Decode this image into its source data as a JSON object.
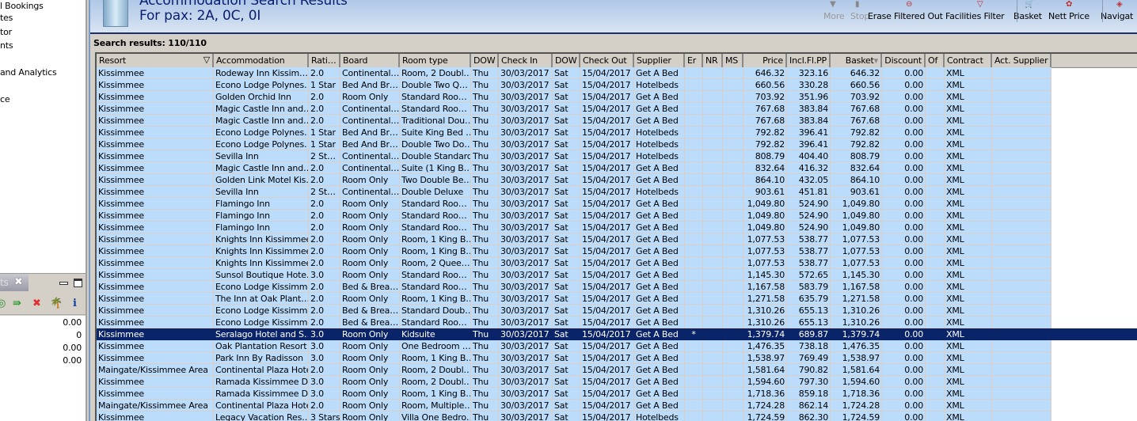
{
  "left_panel": {
    "nav_items": [
      "l Bookings",
      "tes",
      "tor",
      "nts",
      "and Analytics",
      "ce"
    ],
    "tab_label": "ts",
    "values": [
      "0.00",
      "0",
      "0.00",
      "0.00"
    ]
  },
  "header": {
    "title": "Accommodation Search Results",
    "subtitle": "For pax: 2A, 0C, 0I",
    "toolbar": [
      {
        "label": "More",
        "icon": "more-icon",
        "enabled": false
      },
      {
        "label": "Stop",
        "icon": "stop-icon",
        "enabled": false
      },
      {
        "label": "Erase Filtered Out",
        "icon": "erase-filter-icon",
        "enabled": true
      },
      {
        "label": "Facilities Filter",
        "icon": "funnel-icon",
        "enabled": true
      },
      {
        "label": "Basket",
        "icon": "basket-icon",
        "enabled": true
      },
      {
        "label": "Nett Price",
        "icon": "nett-price-icon",
        "enabled": true
      },
      {
        "label": "Navigat",
        "icon": "navigator-icon",
        "enabled": true
      }
    ]
  },
  "results_label": "Search results: 110/110",
  "table": {
    "columns": [
      "Resort",
      "Accommodation",
      "Rati…",
      "Board",
      "Room type",
      "DOW",
      "Check In",
      "DOW",
      "Check Out",
      "Supplier",
      "Er",
      "NR",
      "MS",
      "Price",
      "Incl.Fl.PP",
      "Basket",
      "Discount",
      "Of",
      "Contract",
      "Act. Supplier"
    ],
    "selected_row": 22,
    "rows": [
      [
        "Kissimmee",
        "Rodeway Inn Kissim…",
        "2.0",
        "Continental…",
        "Room, 2 Doubl…",
        "Thu",
        "30/03/2017",
        "Sat",
        "15/04/2017",
        "Get A Bed",
        "",
        "",
        "",
        "646.32",
        "323.16",
        "646.32",
        "0.00",
        "",
        "XML",
        ""
      ],
      [
        "Kissimmee",
        "Econo Lodge Polynes…",
        "1 Star",
        "Bed And Br…",
        "Double Two Q…",
        "Thu",
        "30/03/2017",
        "Sat",
        "15/04/2017",
        "Hotelbeds",
        "",
        "",
        "",
        "660.56",
        "330.28",
        "660.56",
        "0.00",
        "",
        "XML",
        ""
      ],
      [
        "Kissimmee",
        "Golden Orchid Inn",
        "2.0",
        "Room Only",
        "Standard Roo…",
        "Thu",
        "30/03/2017",
        "Sat",
        "15/04/2017",
        "Get A Bed",
        "",
        "",
        "",
        "703.92",
        "351.96",
        "703.92",
        "0.00",
        "",
        "XML",
        ""
      ],
      [
        "Kissimmee",
        "Magic Castle Inn and…",
        "2.0",
        "Continental…",
        "Standard Roo…",
        "Thu",
        "30/03/2017",
        "Sat",
        "15/04/2017",
        "Get A Bed",
        "",
        "",
        "",
        "767.68",
        "383.84",
        "767.68",
        "0.00",
        "",
        "XML",
        ""
      ],
      [
        "Kissimmee",
        "Magic Castle Inn and…",
        "2.0",
        "Continental…",
        "Traditional Dou…",
        "Thu",
        "30/03/2017",
        "Sat",
        "15/04/2017",
        "Get A Bed",
        "",
        "",
        "",
        "767.68",
        "383.84",
        "767.68",
        "0.00",
        "",
        "XML",
        ""
      ],
      [
        "Kissimmee",
        "Econo Lodge Polynes…",
        "1 Star",
        "Bed And Br…",
        "Suite King Bed …",
        "Thu",
        "30/03/2017",
        "Sat",
        "15/04/2017",
        "Hotelbeds",
        "",
        "",
        "",
        "792.82",
        "396.41",
        "792.82",
        "0.00",
        "",
        "XML",
        ""
      ],
      [
        "Kissimmee",
        "Econo Lodge Polynes…",
        "1 Star",
        "Bed And Br…",
        "Double Two Do…",
        "Thu",
        "30/03/2017",
        "Sat",
        "15/04/2017",
        "Hotelbeds",
        "",
        "",
        "",
        "792.82",
        "396.41",
        "792.82",
        "0.00",
        "",
        "XML",
        ""
      ],
      [
        "Kissimmee",
        "Sevilla Inn",
        "2 St…",
        "Continental…",
        "Double Standard",
        "Thu",
        "30/03/2017",
        "Sat",
        "15/04/2017",
        "Hotelbeds",
        "",
        "",
        "",
        "808.79",
        "404.40",
        "808.79",
        "0.00",
        "",
        "XML",
        ""
      ],
      [
        "Kissimmee",
        "Magic Castle Inn and…",
        "2.0",
        "Continental…",
        "Suite (1 King B…",
        "Thu",
        "30/03/2017",
        "Sat",
        "15/04/2017",
        "Get A Bed",
        "",
        "",
        "",
        "832.64",
        "416.32",
        "832.64",
        "0.00",
        "",
        "XML",
        ""
      ],
      [
        "Kissimmee",
        "Golden Link Motel Kis…",
        "2.0",
        "Room Only",
        "Two Double Be…",
        "Thu",
        "30/03/2017",
        "Sat",
        "15/04/2017",
        "Get A Bed",
        "",
        "",
        "",
        "864.10",
        "432.05",
        "864.10",
        "0.00",
        "",
        "XML",
        ""
      ],
      [
        "Kissimmee",
        "Sevilla Inn",
        "2 St…",
        "Continental…",
        "Double Deluxe",
        "Thu",
        "30/03/2017",
        "Sat",
        "15/04/2017",
        "Hotelbeds",
        "",
        "",
        "",
        "903.61",
        "451.81",
        "903.61",
        "0.00",
        "",
        "XML",
        ""
      ],
      [
        "Kissimmee",
        "Flamingo Inn",
        "2.0",
        "Room Only",
        "Standard Roo…",
        "Thu",
        "30/03/2017",
        "Sat",
        "15/04/2017",
        "Get A Bed",
        "",
        "",
        "",
        "1,049.80",
        "524.90",
        "1,049.80",
        "0.00",
        "",
        "XML",
        ""
      ],
      [
        "Kissimmee",
        "Flamingo Inn",
        "2.0",
        "Room Only",
        "Standard Roo…",
        "Thu",
        "30/03/2017",
        "Sat",
        "15/04/2017",
        "Get A Bed",
        "",
        "",
        "",
        "1,049.80",
        "524.90",
        "1,049.80",
        "0.00",
        "",
        "XML",
        ""
      ],
      [
        "Kissimmee",
        "Flamingo Inn",
        "2.0",
        "Room Only",
        "Standard Roo…",
        "Thu",
        "30/03/2017",
        "Sat",
        "15/04/2017",
        "Get A Bed",
        "",
        "",
        "",
        "1,049.80",
        "524.90",
        "1,049.80",
        "0.00",
        "",
        "XML",
        ""
      ],
      [
        "Kissimmee",
        "Knights Inn Kissimmee",
        "2.0",
        "Room Only",
        "Room, 1 King B…",
        "Thu",
        "30/03/2017",
        "Sat",
        "15/04/2017",
        "Get A Bed",
        "",
        "",
        "",
        "1,077.53",
        "538.77",
        "1,077.53",
        "0.00",
        "",
        "XML",
        ""
      ],
      [
        "Kissimmee",
        "Knights Inn Kissimmee",
        "2.0",
        "Room Only",
        "Room, 1 King B…",
        "Thu",
        "30/03/2017",
        "Sat",
        "15/04/2017",
        "Get A Bed",
        "",
        "",
        "",
        "1,077.53",
        "538.77",
        "1,077.53",
        "0.00",
        "",
        "XML",
        ""
      ],
      [
        "Kissimmee",
        "Knights Inn Kissimmee",
        "2.0",
        "Room Only",
        "Room, 2 Quee…",
        "Thu",
        "30/03/2017",
        "Sat",
        "15/04/2017",
        "Get A Bed",
        "",
        "",
        "",
        "1,077.53",
        "538.77",
        "1,077.53",
        "0.00",
        "",
        "XML",
        ""
      ],
      [
        "Kissimmee",
        "Sunsol Boutique Hote…",
        "3.0",
        "Room Only",
        "Standard Roo…",
        "Thu",
        "30/03/2017",
        "Sat",
        "15/04/2017",
        "Get A Bed",
        "",
        "",
        "",
        "1,145.30",
        "572.65",
        "1,145.30",
        "0.00",
        "",
        "XML",
        ""
      ],
      [
        "Kissimmee",
        "Econo Lodge Kissimmee",
        "2.0",
        "Bed & Brea…",
        "Standard Roo…",
        "Thu",
        "30/03/2017",
        "Sat",
        "15/04/2017",
        "Get A Bed",
        "",
        "",
        "",
        "1,167.58",
        "583.79",
        "1,167.58",
        "0.00",
        "",
        "XML",
        ""
      ],
      [
        "Kissimmee",
        "The Inn at Oak Plant…",
        "2.0",
        "Room Only",
        "Room, 1 King B…",
        "Thu",
        "30/03/2017",
        "Sat",
        "15/04/2017",
        "Get A Bed",
        "",
        "",
        "",
        "1,271.58",
        "635.79",
        "1,271.58",
        "0.00",
        "",
        "XML",
        ""
      ],
      [
        "Kissimmee",
        "Econo Lodge Kissimmee",
        "2.0",
        "Bed & Brea…",
        "Standard Doub…",
        "Thu",
        "30/03/2017",
        "Sat",
        "15/04/2017",
        "Get A Bed",
        "",
        "",
        "",
        "1,310.26",
        "655.13",
        "1,310.26",
        "0.00",
        "",
        "XML",
        ""
      ],
      [
        "Kissimmee",
        "Econo Lodge Kissimmee",
        "2.0",
        "Bed & Brea…",
        "Standard Roo…",
        "Thu",
        "30/03/2017",
        "Sat",
        "15/04/2017",
        "Get A Bed",
        "",
        "",
        "",
        "1,310.26",
        "655.13",
        "1,310.26",
        "0.00",
        "",
        "XML",
        ""
      ],
      [
        "Kissimmee",
        "Seralago Hotel and S…",
        "3.0",
        "Room Only",
        "Kidsuite",
        "Thu",
        "30/03/2017",
        "Sat",
        "15/04/2017",
        "Get A Bed",
        "*",
        "",
        "",
        "1,379.74",
        "689.87",
        "1,379.74",
        "0.00",
        "",
        "XML",
        ""
      ],
      [
        "Kissimmee",
        "Oak Plantation Resort",
        "3.0",
        "Room Only",
        "One Bedroom …",
        "Thu",
        "30/03/2017",
        "Sat",
        "15/04/2017",
        "Get A Bed",
        "",
        "",
        "",
        "1,476.35",
        "738.18",
        "1,476.35",
        "0.00",
        "",
        "XML",
        ""
      ],
      [
        "Kissimmee",
        "Park Inn By Radisson",
        "3.0",
        "Room Only",
        "Room, 1 King B…",
        "Thu",
        "30/03/2017",
        "Sat",
        "15/04/2017",
        "Get A Bed",
        "",
        "",
        "",
        "1,538.97",
        "769.49",
        "1,538.97",
        "0.00",
        "",
        "XML",
        ""
      ],
      [
        "Maingate/Kissimmee Area",
        "Continental Plaza Hotel",
        "2.0",
        "Room Only",
        "Room, 2 Doubl…",
        "Thu",
        "30/03/2017",
        "Sat",
        "15/04/2017",
        "Get A Bed",
        "",
        "",
        "",
        "1,581.64",
        "790.82",
        "1,581.64",
        "0.00",
        "",
        "XML",
        ""
      ],
      [
        "Kissimmee",
        "Ramada Kissimmee D…",
        "3.0",
        "Room Only",
        "Room, 2 Doubl…",
        "Thu",
        "30/03/2017",
        "Sat",
        "15/04/2017",
        "Get A Bed",
        "",
        "",
        "",
        "1,594.60",
        "797.30",
        "1,594.60",
        "0.00",
        "",
        "XML",
        ""
      ],
      [
        "Kissimmee",
        "Ramada Kissimmee D…",
        "3.0",
        "Room Only",
        "Room, 1 King B…",
        "Thu",
        "30/03/2017",
        "Sat",
        "15/04/2017",
        "Get A Bed",
        "",
        "",
        "",
        "1,718.36",
        "859.18",
        "1,718.36",
        "0.00",
        "",
        "XML",
        ""
      ],
      [
        "Maingate/Kissimmee Area",
        "Continental Plaza Hotel",
        "2.0",
        "Room Only",
        "Room, Multiple…",
        "Thu",
        "30/03/2017",
        "Sat",
        "15/04/2017",
        "Get A Bed",
        "",
        "",
        "",
        "1,724.28",
        "862.14",
        "1,724.28",
        "0.00",
        "",
        "XML",
        ""
      ],
      [
        "Kissimmee",
        "Legacy Vacation Res…",
        "3 Stars",
        "Room Only",
        "Villa One Bedro…",
        "Thu",
        "30/03/2017",
        "Sat",
        "15/04/2017",
        "Hotelbeds",
        "",
        "",
        "",
        "1,724.59",
        "862.30",
        "1,724.59",
        "0.00",
        "",
        "XML",
        ""
      ]
    ]
  }
}
